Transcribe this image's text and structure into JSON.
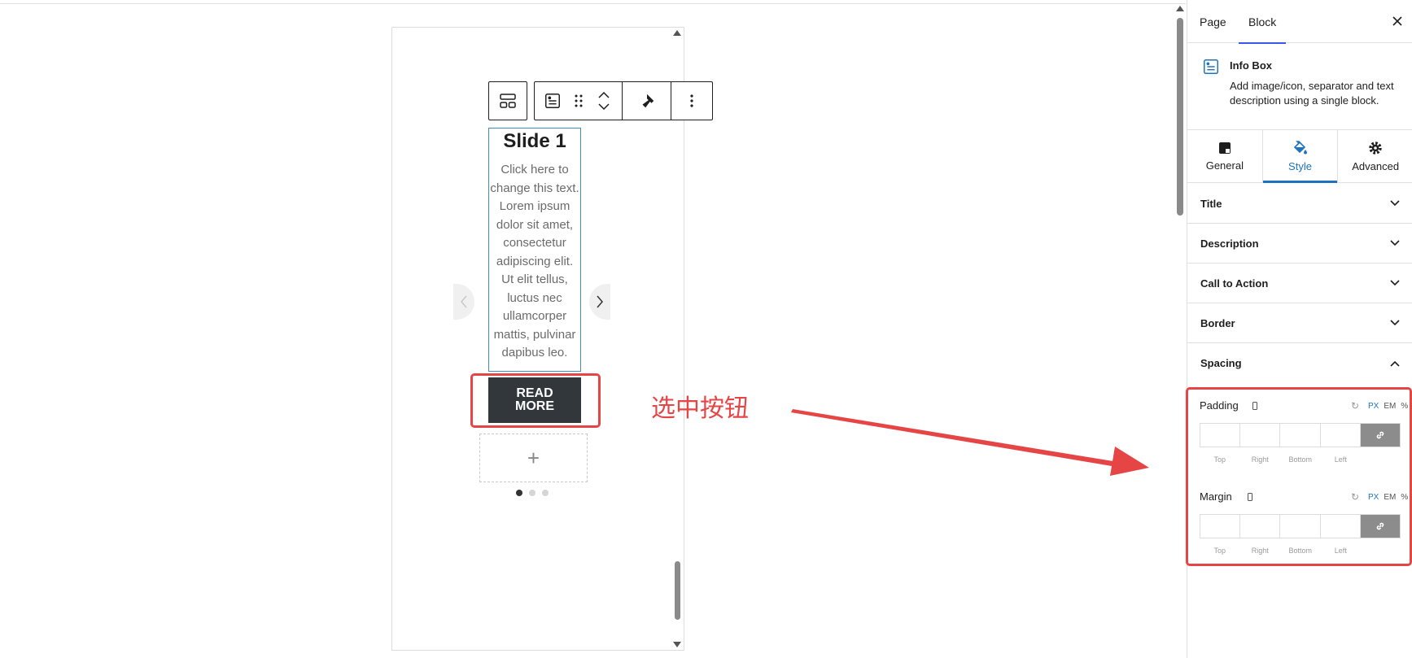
{
  "canvas": {
    "slide": {
      "title": "Slide 1",
      "description": "Click here to change this text. Lorem ipsum dolor sit amet, consectetur adipiscing elit. Ut elit tellus, luctus nec ullamcorper mattis, pulvinar dapibus leo.",
      "button_label": "READ\nMORE"
    },
    "appender_symbol": "+",
    "pagination": {
      "total": 3,
      "active": 1
    },
    "annotation_text": "选中按钮"
  },
  "sidebar": {
    "tabs": [
      {
        "label": "Page",
        "active": false
      },
      {
        "label": "Block",
        "active": true
      }
    ],
    "block": {
      "name": "Info Box",
      "description": "Add image/icon, separator and text description using a single block.",
      "icon": "infobox-icon"
    },
    "panel_tabs": [
      {
        "label": "General",
        "icon": "layout-icon",
        "active": false
      },
      {
        "label": "Style",
        "icon": "paint-bucket-icon",
        "active": true
      },
      {
        "label": "Advanced",
        "icon": "gear-icon",
        "active": false
      }
    ],
    "sections": [
      {
        "label": "Title",
        "expanded": false
      },
      {
        "label": "Description",
        "expanded": false
      },
      {
        "label": "Call to Action",
        "expanded": false
      },
      {
        "label": "Border",
        "expanded": false
      },
      {
        "label": "Spacing",
        "expanded": true
      }
    ],
    "spacing": {
      "units": [
        "PX",
        "EM",
        "%"
      ],
      "active_unit": "PX",
      "padding": {
        "label": "Padding",
        "sides": [
          "Top",
          "Right",
          "Bottom",
          "Left"
        ]
      },
      "margin": {
        "label": "Margin",
        "sides": [
          "Top",
          "Right",
          "Bottom",
          "Left"
        ]
      }
    }
  },
  "colors": {
    "accent": "#1e73be",
    "annotation": "#e64545",
    "button_bg": "#32373c"
  }
}
